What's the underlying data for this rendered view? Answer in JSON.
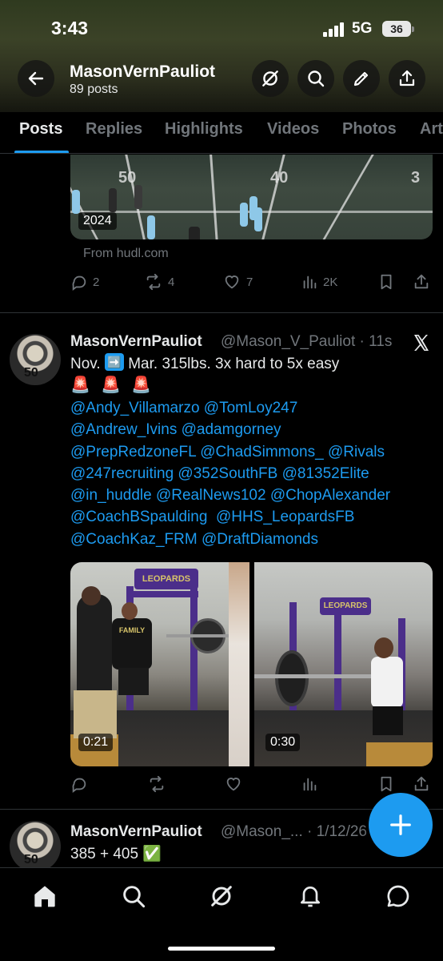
{
  "status_bar": {
    "time": "3:43",
    "network": "5G",
    "battery": "36"
  },
  "header": {
    "name": "MasonVernPauliot",
    "post_count": "89 posts",
    "icons": [
      "back-arrow-icon",
      "grok-icon",
      "search-icon",
      "pencil-icon",
      "share-icon"
    ]
  },
  "tabs": [
    {
      "label": "Posts",
      "active": true
    },
    {
      "label": "Replies",
      "active": false
    },
    {
      "label": "Highlights",
      "active": false
    },
    {
      "label": "Videos",
      "active": false
    },
    {
      "label": "Photos",
      "active": false
    },
    {
      "label": "Art",
      "active": false
    }
  ],
  "post1": {
    "video_year": "2024",
    "yard_markers": [
      "50",
      "40",
      "3"
    ],
    "from": "From hudl.com",
    "stats": {
      "replies": "2",
      "reposts": "4",
      "likes": "7",
      "views": "2K"
    }
  },
  "post2": {
    "name": "MasonVernPauliot",
    "handle_time": "@Mason_V_Pauliot · 11s",
    "text_before": "Nov.",
    "text_after": "Mar.  315lbs. 3x hard to 5x easy",
    "arrow_emoji": "➡️",
    "sirens": [
      "🚨",
      "🚨",
      "🚨"
    ],
    "mention_lines": [
      "@Andy_Villamarzo @TomLoy247",
      "@Andrew_Ivins @adamgorney",
      "@PrepRedzoneFL @ChadSimmons_ @Rivals",
      "@247recruiting @352SouthFB @81352Elite",
      "@in_huddle @RealNews102 @ChopAlexander",
      "@CoachBSpaulding  @HHS_LeopardsFB",
      "@CoachKaz_FRM @DraftDiamonds"
    ],
    "videos": [
      {
        "duration": "0:21",
        "sign": "LEOPARDS",
        "shirt": "FAMILY"
      },
      {
        "duration": "0:30",
        "sign": "LEOPARDS"
      }
    ],
    "avatar_number": "50",
    "brand_icon": "x-logo-icon"
  },
  "post3": {
    "name": "MasonVernPauliot",
    "handle_time": "@Mason_... · 1/12/26",
    "text": "385 + 405 ✅",
    "avatar_number": "50"
  },
  "fab": {
    "icon": "plus-icon"
  },
  "bottom_nav": [
    "home-icon",
    "search-icon",
    "grok-icon",
    "notifications-icon",
    "messages-icon"
  ],
  "colors": {
    "accent": "#1d9bf0",
    "muted": "#71767b",
    "text": "#e7e9ea",
    "background": "#000000"
  }
}
